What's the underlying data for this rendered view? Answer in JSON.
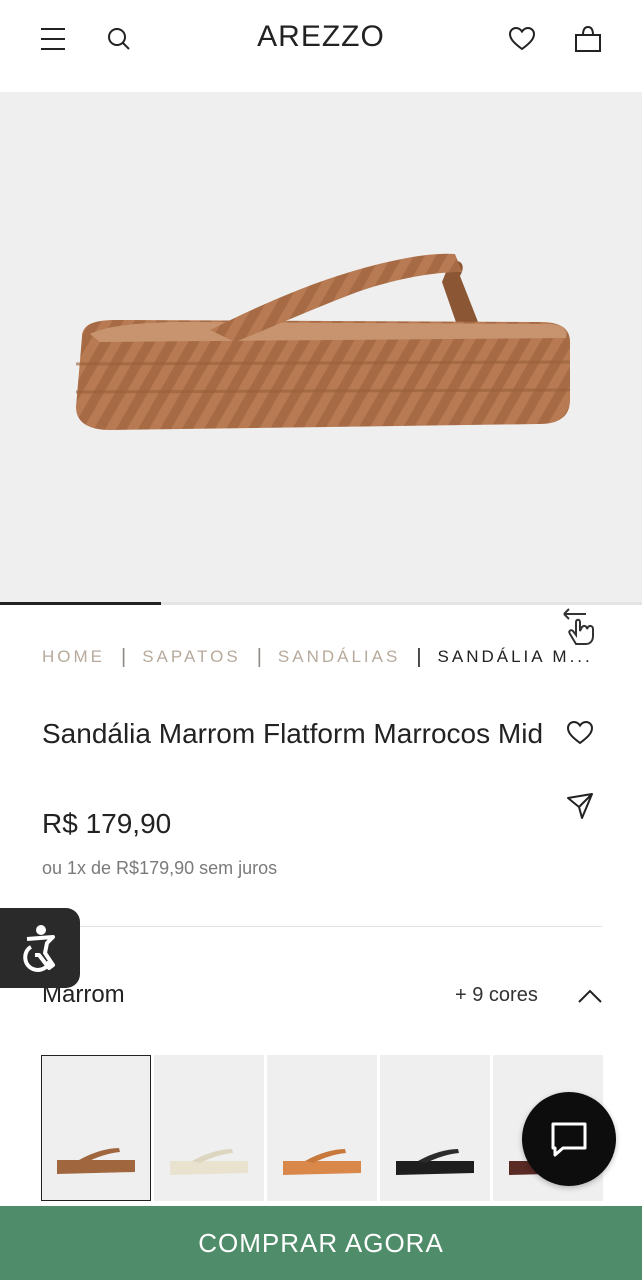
{
  "header": {
    "brand": "AREZZO",
    "icons": [
      "menu-icon",
      "search-icon",
      "heart-icon",
      "bag-icon"
    ]
  },
  "gallery": {
    "progress": 0.25,
    "icons": [
      "swipe-hand-icon"
    ]
  },
  "breadcrumb": {
    "items": [
      "HOME",
      "SAPATOS",
      "SANDÁLIAS"
    ],
    "current": "SANDÁLIA M..."
  },
  "product": {
    "title": "Sandália Marrom Flatform Marrocos Mid",
    "price": "R$ 179,90",
    "installments": "ou 1x de R$179,90 sem juros"
  },
  "colors": {
    "selected_name": "Marrom",
    "more_label": "+ 9 cores",
    "swatches": [
      {
        "color": "#a0673f",
        "selected": true
      },
      {
        "color": "#e8e2cf",
        "selected": false
      },
      {
        "color": "#d9884a",
        "selected": false
      },
      {
        "color": "#1e1e1e",
        "selected": false
      },
      {
        "color": "#5a2a25",
        "selected": false
      }
    ]
  },
  "cta": {
    "label": "COMPRAR AGORA",
    "color": "#4f8d6a"
  },
  "theme": {
    "product_color": "#b77a52",
    "text": "#222222",
    "breadcrumb_muted": "#b7aa9c"
  }
}
